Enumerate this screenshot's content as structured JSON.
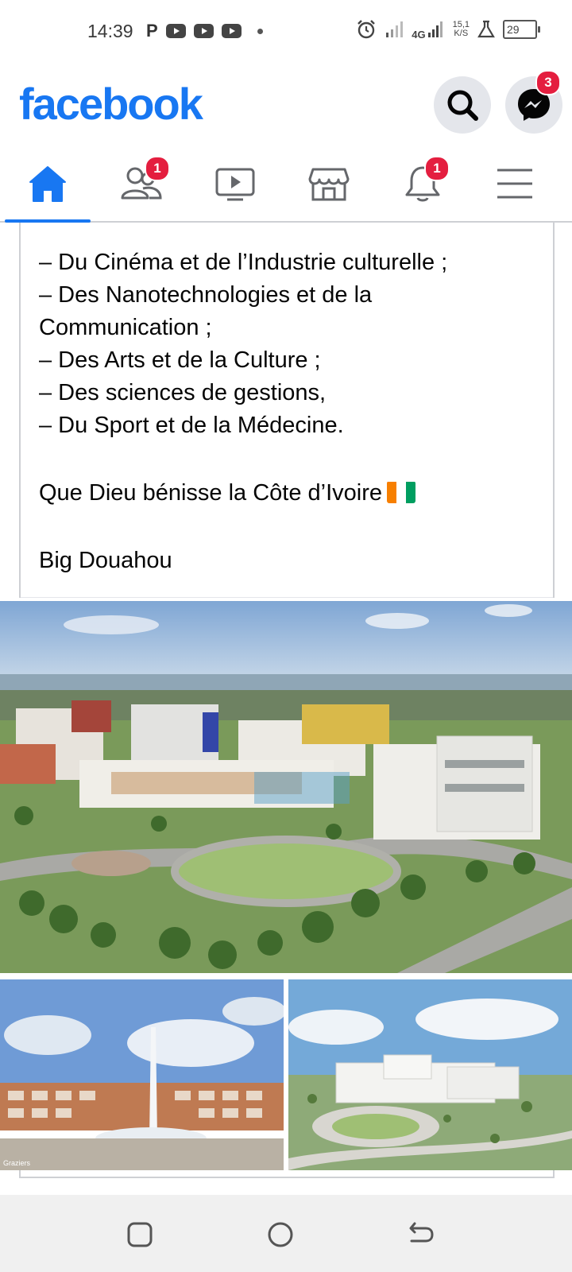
{
  "status_bar": {
    "time": "14:39",
    "notif_p": "P",
    "network": "4G",
    "speed_value": "15,1",
    "speed_unit": "K/S",
    "battery": "29"
  },
  "header": {
    "logo": "facebook",
    "search_icon": "search-icon",
    "messenger_icon": "messenger-icon",
    "messenger_badge": "3"
  },
  "nav_tabs": {
    "home_icon": "home-icon",
    "friends_icon": "friends-icon",
    "friends_badge": "1",
    "watch_icon": "video-icon",
    "marketplace_icon": "store-icon",
    "notifications_icon": "bell-icon",
    "notifications_badge": "1",
    "menu_icon": "hamburger-menu-icon",
    "active_tab": "home"
  },
  "post": {
    "lines": [
      "– Du Cinéma et de l’Industrie culturelle ;",
      "– Des Nanotechnologies et de la Communication ;",
      "– Des Arts et de la Culture ;",
      "– Des sciences de gestions,",
      "– Du Sport et de la Médecine."
    ],
    "blessing": "Que Dieu bénisse la Côte d’Ivoire",
    "signature": "Big Douahou",
    "flag_colors": [
      "#f77f00",
      "#ffffff",
      "#009e60"
    ]
  },
  "photo_caption_small": "Graziers",
  "colors": {
    "brand": "#1877f2",
    "badge": "#e41e3f"
  }
}
